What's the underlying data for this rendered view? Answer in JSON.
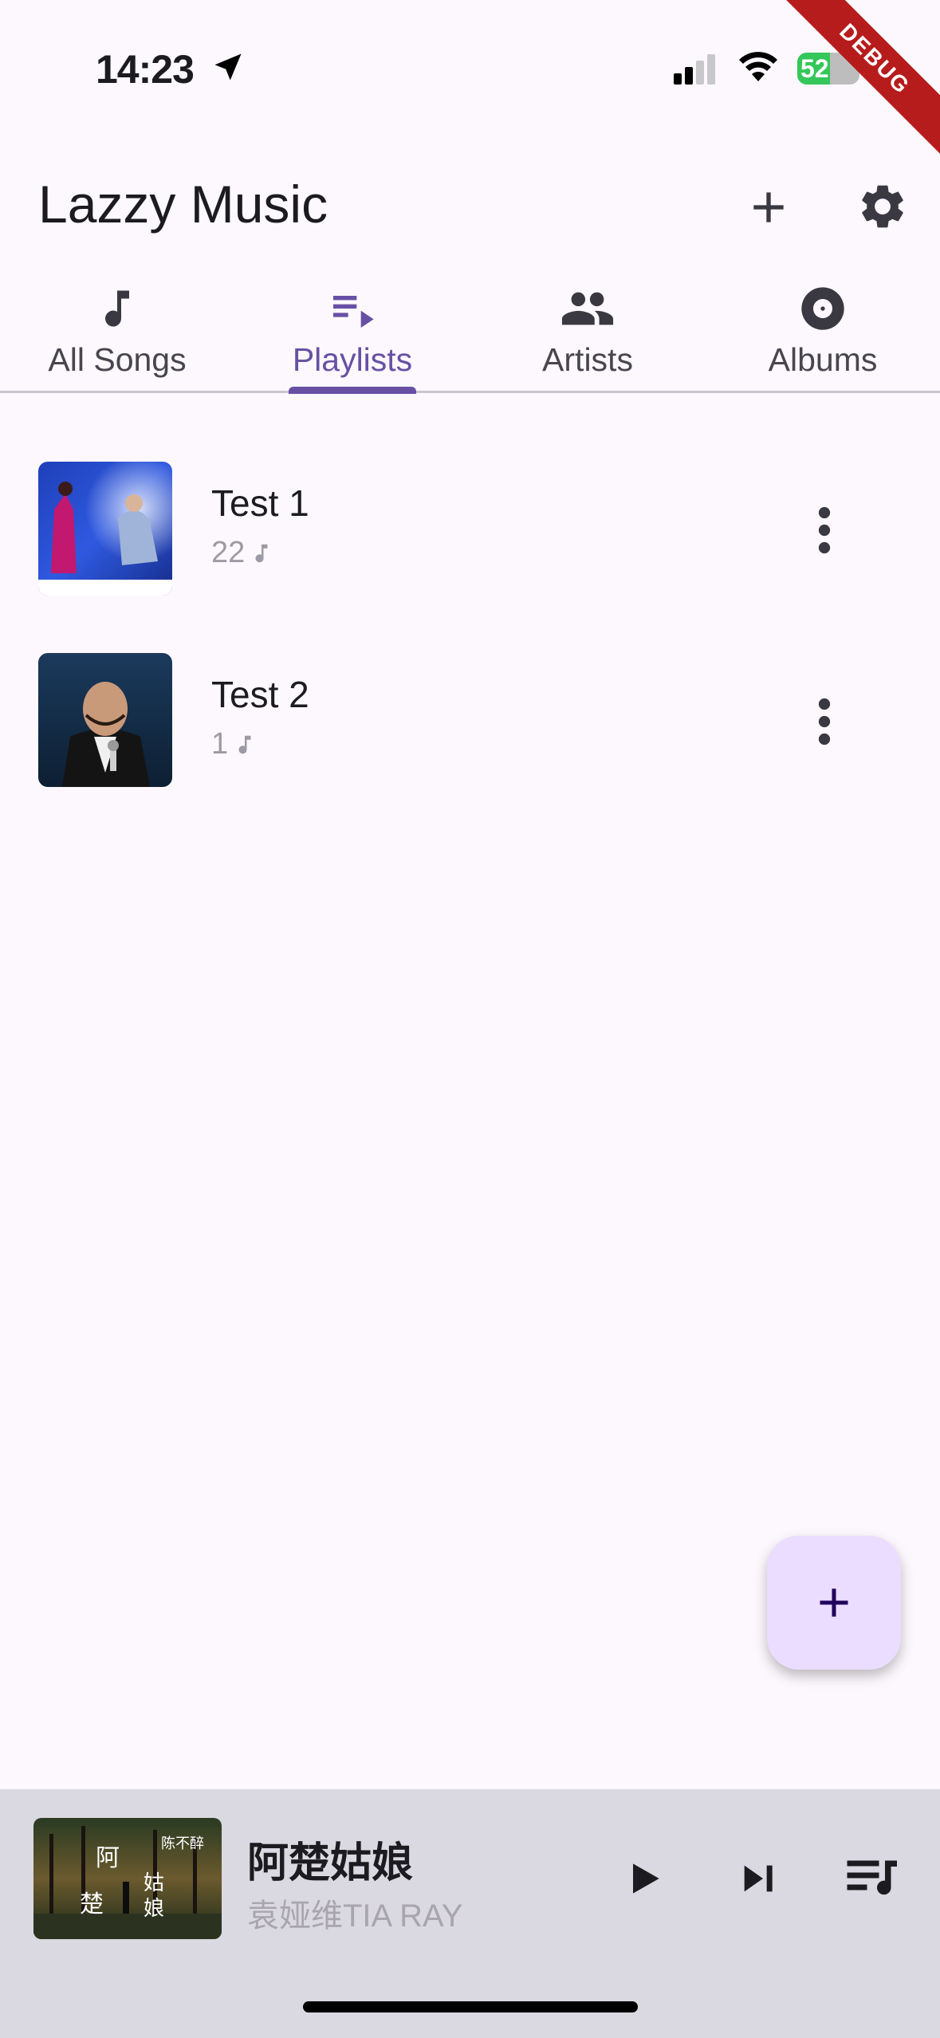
{
  "status_bar": {
    "time": "14:23",
    "battery": "52",
    "battery_level": 0.52,
    "debug_banner": "DEBUG"
  },
  "app": {
    "title": "Lazzy Music"
  },
  "tabs": [
    {
      "label": "All Songs",
      "icon": "music-note-icon"
    },
    {
      "label": "Playlists",
      "icon": "playlist-play-icon",
      "active": true
    },
    {
      "label": "Artists",
      "icon": "people-icon"
    },
    {
      "label": "Albums",
      "icon": "album-icon"
    }
  ],
  "playlists": [
    {
      "name": "Test 1",
      "count": "22"
    },
    {
      "name": "Test 2",
      "count": "1"
    }
  ],
  "now_playing": {
    "title": "阿楚姑娘",
    "artist": "袁娅维TIA RAY",
    "cover_text": [
      "阿",
      "楚",
      "姑",
      "娘",
      "陈不醉"
    ]
  },
  "colors": {
    "accent": "#6750a4",
    "background": "#fcf8fd",
    "fab": "#eaddff",
    "mini_player": "#dad8e1"
  }
}
